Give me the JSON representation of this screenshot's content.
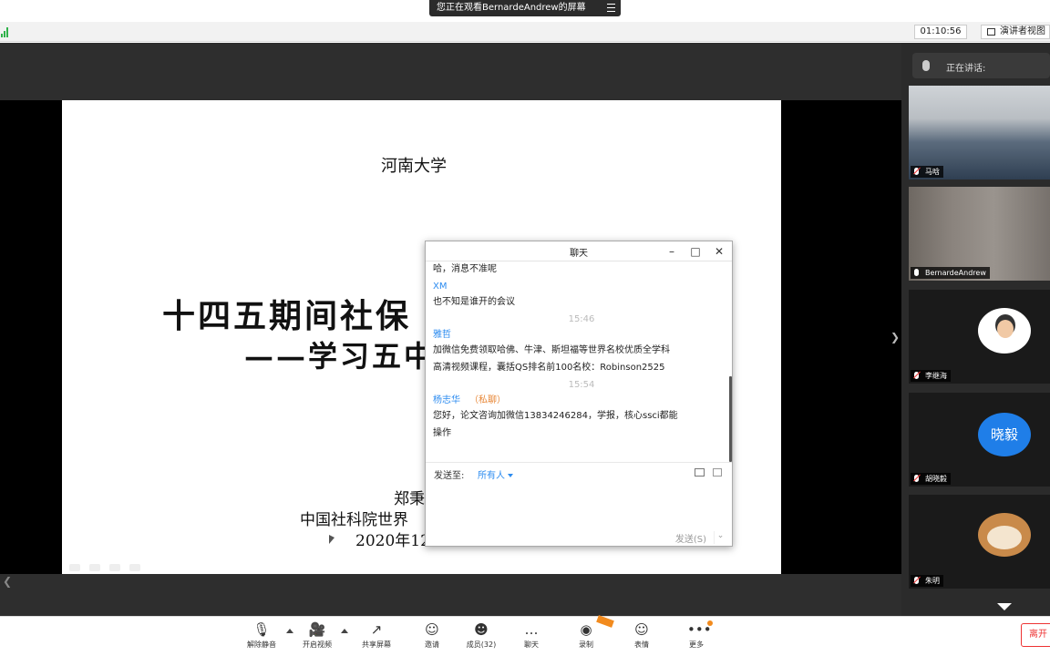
{
  "banner": {
    "text": "您正在观看BernardeAndrew的屏幕"
  },
  "infobar": {
    "timer": "01:10:56",
    "speaker_view": "演讲者视图"
  },
  "slide": {
    "university": "河南大学",
    "title_line1": "十四五期间社保",
    "title_line2": "——学习五中",
    "author": "郑秉",
    "org": "中国社科院世界",
    "date": "2020年12"
  },
  "chat": {
    "title": "聊天",
    "messages": [
      {
        "kind": "text",
        "text": "哈，消息不准呢"
      },
      {
        "kind": "sender",
        "text": "XM"
      },
      {
        "kind": "text",
        "text": "也不知是谁开的会议"
      },
      {
        "kind": "time",
        "text": "15:46"
      },
      {
        "kind": "sender",
        "text": "雅哲"
      },
      {
        "kind": "text",
        "text": "加微信免费领取哈佛、牛津、斯坦福等世界名校优质全学科"
      },
      {
        "kind": "text",
        "text": "高清视频课程，囊括QS排名前100名校：Robinson2525"
      },
      {
        "kind": "time",
        "text": "15:54"
      },
      {
        "kind": "sender",
        "text": "杨志华",
        "private": "（私聊）"
      },
      {
        "kind": "text",
        "text": "您好，论文咨询加微信13834246284，学报，核心ssci都能"
      },
      {
        "kind": "text",
        "text": "操作"
      }
    ],
    "send_to_label": "发送至:",
    "recipient": "所有人",
    "send_button": "发送(S)"
  },
  "participants": {
    "speaking_label": "正在讲话:",
    "tiles": [
      {
        "name": "马晗",
        "kind": "classroom"
      },
      {
        "name": "BernardeAndrew",
        "kind": "video"
      },
      {
        "name": "李继海",
        "kind": "avatar"
      },
      {
        "name": "胡晓毅",
        "kind": "initials",
        "initials": "晓毅",
        "color": "#1f7ee8"
      },
      {
        "name": "朱明",
        "kind": "dog"
      }
    ]
  },
  "toolbar": {
    "items": [
      {
        "label": "解除静音",
        "icon": "mic-muted-icon"
      },
      {
        "label": "开启视频",
        "icon": "video-off-icon"
      },
      {
        "label": "共享屏幕",
        "icon": "share-screen-icon"
      },
      {
        "label": "邀请",
        "icon": "invite-icon"
      },
      {
        "label": "成员(32)",
        "icon": "participants-icon"
      },
      {
        "label": "聊天",
        "icon": "chat-icon"
      },
      {
        "label": "录制",
        "icon": "record-icon"
      },
      {
        "label": "表情",
        "icon": "emoji-icon"
      },
      {
        "label": "更多",
        "icon": "more-icon"
      }
    ],
    "leave": "离开"
  },
  "colors": {
    "accent": "#2d8cf0",
    "leave": "#e33333",
    "badge": "#f28b1e"
  }
}
